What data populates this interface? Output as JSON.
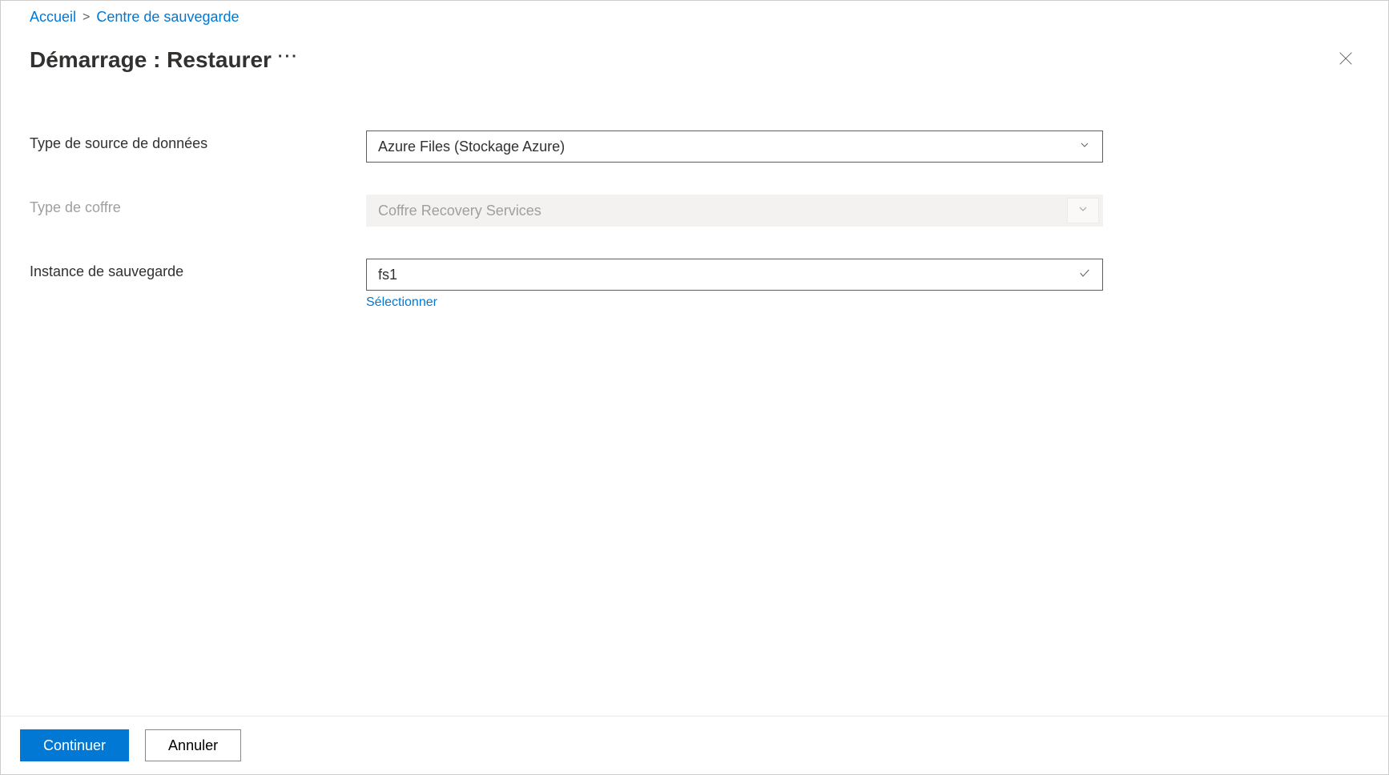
{
  "breadcrumb": {
    "home": "Accueil",
    "backup_center": "Centre de sauvegarde"
  },
  "header": {
    "title": "Démarrage : Restaurer"
  },
  "form": {
    "datasource_type": {
      "label": "Type de source de données",
      "value": "Azure Files (Stockage Azure)"
    },
    "vault_type": {
      "label": "Type de coffre",
      "value": "Coffre Recovery Services"
    },
    "backup_instance": {
      "label": "Instance de sauvegarde",
      "value": "fs1",
      "select_link": "Sélectionner"
    }
  },
  "footer": {
    "continue": "Continuer",
    "cancel": "Annuler"
  }
}
